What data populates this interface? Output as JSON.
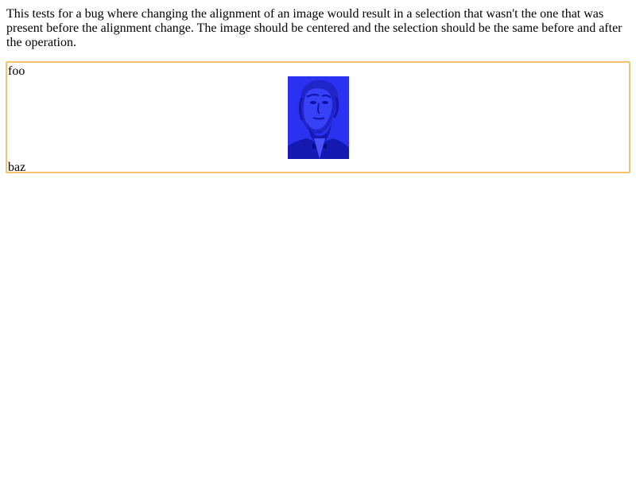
{
  "description": "This tests for a bug where changing the alignment of an image would result in a selection that wasn't the one that was present before the alignment change. The image should be centered and the selection should be the same before and after the operation.",
  "editor": {
    "top_text": "foo",
    "bottom_text": "baz",
    "image_name": "portrait-image"
  },
  "colors": {
    "border": "#f6c36a",
    "image_tint": "#2a31f0"
  }
}
